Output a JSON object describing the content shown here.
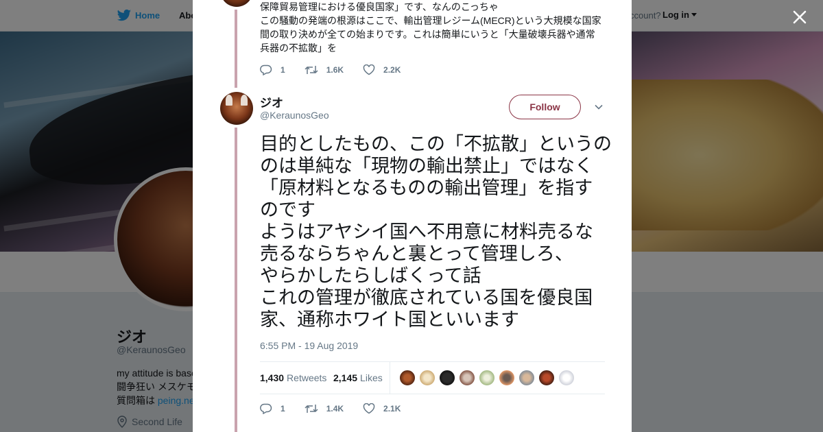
{
  "nav": {
    "home": "Home",
    "about": "Abo",
    "account_prompt": "ccount?",
    "login": "Log in"
  },
  "profile": {
    "name": "ジオ",
    "handle": "@KeraunosGeo",
    "bio_lines": [
      "my attitude is base",
      "闘争狂い メスケモ",
      "質問箱は "
    ],
    "bio_link": "peing.ne",
    "location": "Second Life"
  },
  "previous_tweet": {
    "lines": [
      "保障貿易管理における優良国家」です、なんのこっちゃ",
      "この騒動の発端の根源はここで、輸出管理レジーム(MECR)という大規模な国家",
      "間の取り決めが全ての始まりです。これは簡単にいうと「大量破壊兵器や通常",
      "兵器の不拡散」を"
    ],
    "replies": "1",
    "retweets": "1.6K",
    "likes": "2.2K"
  },
  "tweet": {
    "author_name": "ジオ",
    "author_handle": "@KeraunosGeo",
    "follow_label": "Follow",
    "body_lines": [
      "目的としたもの、この「不拡散」というの",
      "のは単純な「現物の輸出禁止」ではなく",
      "「原材料となるものの輸出管理」を指す",
      "のです",
      "ようはアヤシイ国へ不用意に材料売るな",
      "売るならちゃんと裏とって管理しろ、",
      "やらかしたらしばくって話",
      "これの管理が徹底されている国を優良国",
      "家、通称ホワイト国といいます"
    ],
    "timestamp": "6:55 PM - 19 Aug 2019",
    "retweet_count": "1,430",
    "retweet_label": "Retweets",
    "like_count": "2,145",
    "like_label": "Likes",
    "replies": "1",
    "retweets_short": "1.4K",
    "likes_short": "2.1K"
  },
  "colors": {
    "accent": "#1da1f2",
    "follow": "#8a3445",
    "thread_line": "#c9a3ae",
    "muted": "#657786"
  },
  "icons": [
    "twitter-bird-icon",
    "caret-down-icon",
    "close-icon",
    "reply-icon",
    "retweet-icon",
    "like-icon",
    "chevron-down-icon",
    "location-icon"
  ]
}
